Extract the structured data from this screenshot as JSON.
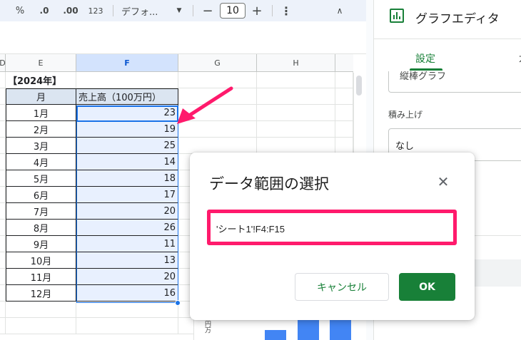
{
  "toolbar": {
    "percent": "%",
    "decrease_decimal": ".0",
    "increase_decimal": ".00",
    "number_format": "123",
    "font_name": "デフォ...",
    "font_size": "10",
    "minus": "−",
    "plus": "+",
    "more": "⋮",
    "collapse": "∧"
  },
  "grid": {
    "columns": [
      "D",
      "E",
      "F",
      "G",
      "H"
    ],
    "selected_column": "F",
    "year_label": "【2024年】",
    "header_month": "月",
    "header_sales": "売上高（100万円）",
    "rows": [
      {
        "month": "1月",
        "sales": "23"
      },
      {
        "month": "2月",
        "sales": "19"
      },
      {
        "month": "3月",
        "sales": "25"
      },
      {
        "month": "4月",
        "sales": "14"
      },
      {
        "month": "5月",
        "sales": "18"
      },
      {
        "month": "6月",
        "sales": "17"
      },
      {
        "month": "7月",
        "sales": "20"
      },
      {
        "month": "8月",
        "sales": "26"
      },
      {
        "month": "9月",
        "sales": "11"
      },
      {
        "month": "10月",
        "sales": "13"
      },
      {
        "month": "11月",
        "sales": "20"
      },
      {
        "month": "12月",
        "sales": "16"
      }
    ]
  },
  "panel": {
    "title": "グラフエディタ",
    "tab_setup": "設定",
    "tab_customize": "カ",
    "chart_type": "縦棒グラフ",
    "stacking_label": "積み上げ",
    "stacking_value": "なし"
  },
  "chart_peek": {
    "axis_label": "(円万"
  },
  "dialog": {
    "title": "データ範囲の選択",
    "range_value": "'シート1'!F4:F15",
    "cancel_label": "キャンセル",
    "ok_label": "OK"
  },
  "colors": {
    "accent_green": "#188038",
    "highlight_pink": "#ff1a6c",
    "selection_blue": "#1a73e8"
  }
}
